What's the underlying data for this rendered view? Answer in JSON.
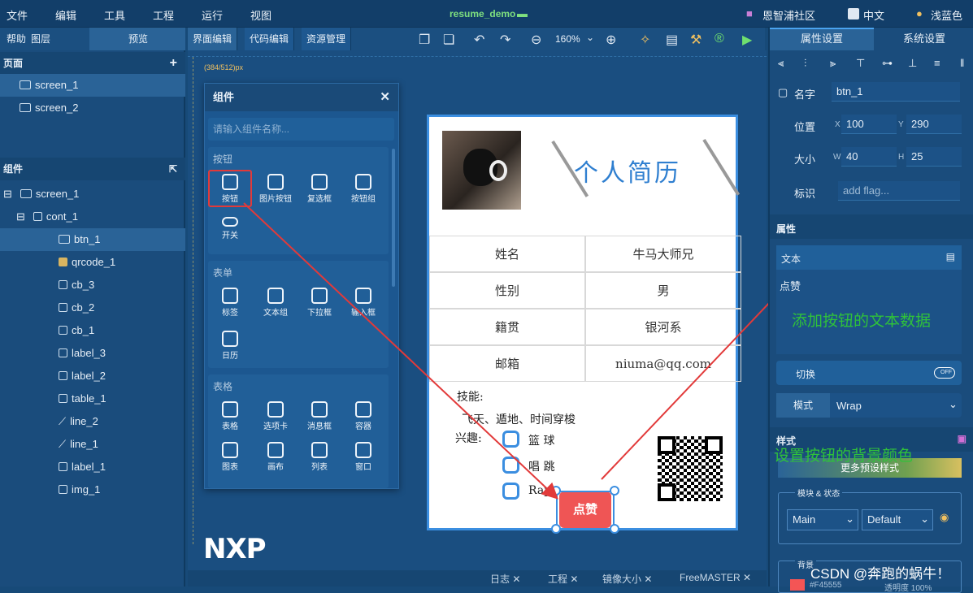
{
  "menu": {
    "file": "文件",
    "edit": "编辑",
    "tools": "工具",
    "project": "工程",
    "run": "运行",
    "view": "视图"
  },
  "project_title": "resume_demo",
  "menu_right": {
    "community": "恩智浦社区",
    "language": "中文",
    "theme": "浅蓝色"
  },
  "left_tabs": {
    "help": "帮助",
    "layers": "图层",
    "preview": "预览"
  },
  "pages": {
    "header": "页面",
    "items": [
      "screen_1",
      "screen_2"
    ]
  },
  "components": {
    "header": "组件",
    "tree": [
      "screen_1",
      "cont_1",
      "btn_1",
      "qrcode_1",
      "cb_3",
      "cb_2",
      "cb_1",
      "label_3",
      "label_2",
      "table_1",
      "line_2",
      "line_1",
      "label_1",
      "img_1"
    ]
  },
  "center_tabs": {
    "ui": "界面编辑",
    "code": "代码编辑",
    "res": "资源管理"
  },
  "zoom": "160%",
  "ruler_text": "(384/512)px",
  "component_panel": {
    "title": "组件",
    "search_placeholder": "请输入组件名称...",
    "groups": [
      {
        "name": "按钮",
        "items": [
          "按钮",
          "图片按钮",
          "复选框",
          "按钮组",
          "开关"
        ]
      },
      {
        "name": "表单",
        "items": [
          "标签",
          "文本组",
          "下拉框",
          "输入框",
          "日历"
        ]
      },
      {
        "name": "表格",
        "items": [
          "表格",
          "选项卡",
          "消息框",
          "容器",
          "图表",
          "画布",
          "列表",
          "窗口"
        ]
      }
    ]
  },
  "resume": {
    "title": "个人简历",
    "rows": [
      [
        "姓名",
        "牛马大师兄"
      ],
      [
        "性别",
        "男"
      ],
      [
        "籍贯",
        "银河系"
      ],
      [
        "邮箱",
        "niuma@qq.com"
      ]
    ],
    "skills_label": "技能:",
    "skills": "飞天、遁地、时间穿梭",
    "hobby_label": "兴趣:",
    "hobbies": [
      "篮 球",
      "唱 跳",
      "Rap"
    ],
    "button": "点赞"
  },
  "right_tabs": {
    "props": "属性设置",
    "system": "系统设置"
  },
  "props": {
    "name_label": "名字",
    "name": "btn_1",
    "pos_label": "位置",
    "x_label": "X",
    "x": "100",
    "y_label": "Y",
    "y": "290",
    "size_label": "大小",
    "w_label": "W",
    "w": "40",
    "h_label": "H",
    "h": "25",
    "flag_label": "标识",
    "flag_placeholder": "add flag...",
    "attr_header": "属性",
    "text_label": "文本",
    "text_value": "点赞",
    "toggle_label": "切换",
    "toggle_state": "OFF",
    "mode_label": "模式",
    "mode_value": "Wrap",
    "style_header": "样式",
    "preset_button": "更多预设样式",
    "module_label": "模块 & 状态",
    "module_value": "Main",
    "state_value": "Default",
    "bg_label": "背景",
    "bg_color": "#F45555",
    "opacity_label": "透明度 100%"
  },
  "annotations": {
    "text_data": "添加按钮的文本数据",
    "bg_color": "设置按钮的背景颜色"
  },
  "bottom": {
    "log": "日志",
    "project": "工程",
    "mirror": "镜像大小",
    "freemaster": "FreeMASTER"
  },
  "logo": "NXP",
  "watermark": "CSDN @奔跑的蜗牛！"
}
